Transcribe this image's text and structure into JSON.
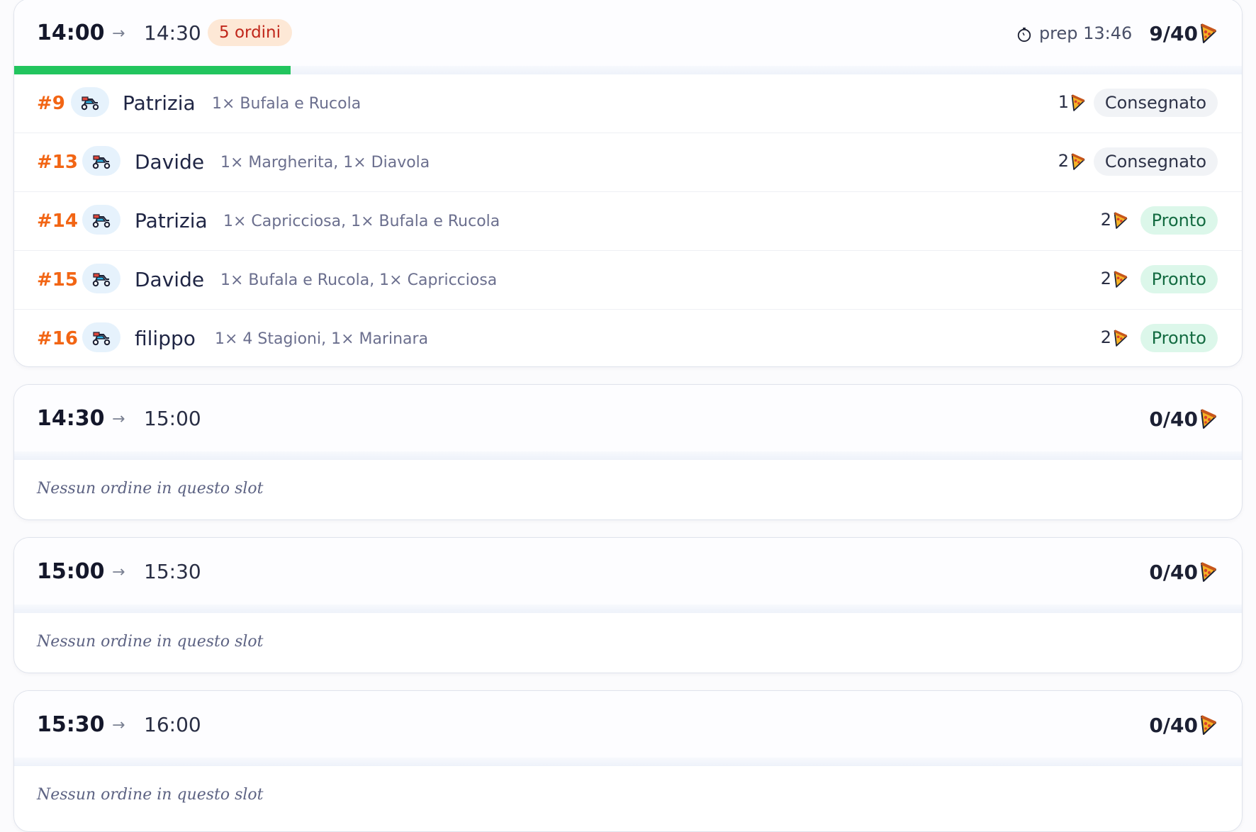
{
  "colors": {
    "order_id": "#f26514",
    "progress": "#22c55e",
    "count_badge_bg": "#fde8d6",
    "count_badge_text": "#c0261a",
    "status_delivered_bg": "#f1f3f6",
    "status_ready_bg": "#dcf7ea",
    "status_ready_text": "#136b41"
  },
  "icons": {
    "prep": "stopwatch-icon",
    "capacity": "pizza-slice-icon",
    "delivery": "scooter-icon"
  },
  "slots": [
    {
      "start": "14:00",
      "arrow": "→",
      "end": "14:30",
      "order_count": "5 ordini",
      "prep": "prep 13:46",
      "capacity": "9/40",
      "fill_fraction": 0.225,
      "orders": [
        {
          "id": "#9",
          "name": "Patrizia",
          "items": "1× Bufala e Rucola",
          "qty": "1",
          "status": "Consegnato",
          "status_type": "delivered"
        },
        {
          "id": "#13",
          "name": "Davide",
          "items": "1× Margherita, 1× Diavola",
          "qty": "2",
          "status": "Consegnato",
          "status_type": "delivered"
        },
        {
          "id": "#14",
          "name": "Patrizia",
          "items": "1× Capricciosa, 1× Bufala e Rucola",
          "qty": "2",
          "status": "Pronto",
          "status_type": "ready"
        },
        {
          "id": "#15",
          "name": "Davide",
          "items": "1× Bufala e Rucola, 1× Capricciosa",
          "qty": "2",
          "status": "Pronto",
          "status_type": "ready"
        },
        {
          "id": "#16",
          "name": "filippo",
          "items": "1× 4 Stagioni, 1× Marinara",
          "qty": "2",
          "status": "Pronto",
          "status_type": "ready"
        }
      ]
    },
    {
      "start": "14:30",
      "arrow": "→",
      "end": "15:00",
      "capacity": "0/40",
      "empty": "Nessun ordine in questo slot"
    },
    {
      "start": "15:00",
      "arrow": "→",
      "end": "15:30",
      "capacity": "0/40",
      "empty": "Nessun ordine in questo slot"
    },
    {
      "start": "15:30",
      "arrow": "→",
      "end": "16:00",
      "capacity": "0/40",
      "empty": "Nessun ordine in questo slot"
    }
  ]
}
